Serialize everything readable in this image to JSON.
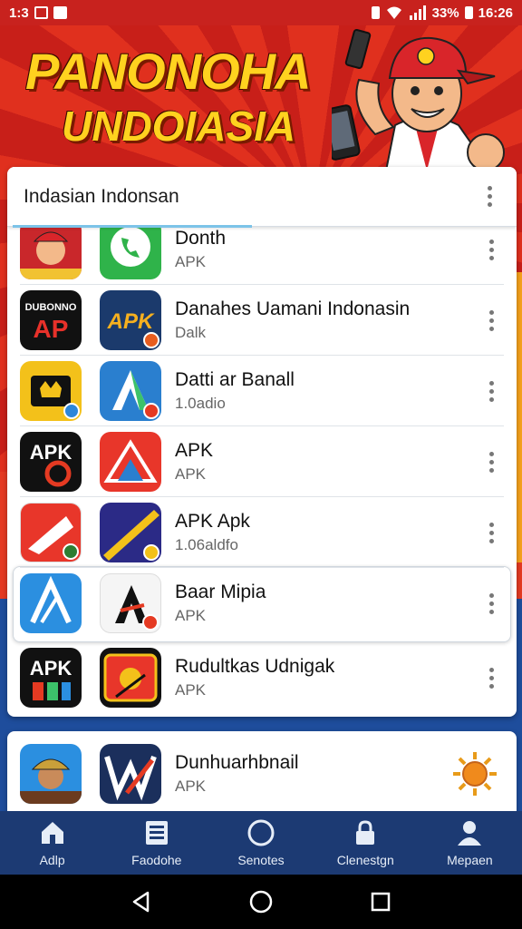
{
  "status_bar": {
    "left_time": "1:3",
    "battery": "33%",
    "time": "16:26"
  },
  "banner": {
    "title": "PANONOHA",
    "subtitle": "UNDOIASIA"
  },
  "card": {
    "title": "Indasian Indonsan",
    "rows": [
      {
        "name": "Donth",
        "sub": "APK"
      },
      {
        "name": "Danahes Uamani Indonasin",
        "sub": "Dalk"
      },
      {
        "name": "Datti ar Banall",
        "sub": "1.0adio"
      },
      {
        "name": "APK",
        "sub": "APK"
      },
      {
        "name": "APK Apk",
        "sub": "1.06aldfo"
      },
      {
        "name": "Baar Mipia",
        "sub": "APK"
      },
      {
        "name": "Rudultkas Udnigak",
        "sub": "APK"
      }
    ],
    "icon_labels": {
      "r1_icon1": "DUBONNO",
      "r1_icon2": "APK",
      "r3_icon1": "APK",
      "r6_icon1": "APK"
    }
  },
  "card2": {
    "row": {
      "name": "Dunhuarhbnail",
      "sub": "APK"
    }
  },
  "bottom_nav": [
    {
      "label": "Adlp",
      "icon": "home-icon"
    },
    {
      "label": "Faodohe",
      "icon": "list-icon"
    },
    {
      "label": "Senotes",
      "icon": "compass-icon"
    },
    {
      "label": "Clenestgn",
      "icon": "lock-icon"
    },
    {
      "label": "Mepaen",
      "icon": "person-icon"
    }
  ],
  "colors": {
    "status_red": "#c8221e",
    "nav_blue": "#1c3a73",
    "banner_yellow": "#ffd21f"
  }
}
